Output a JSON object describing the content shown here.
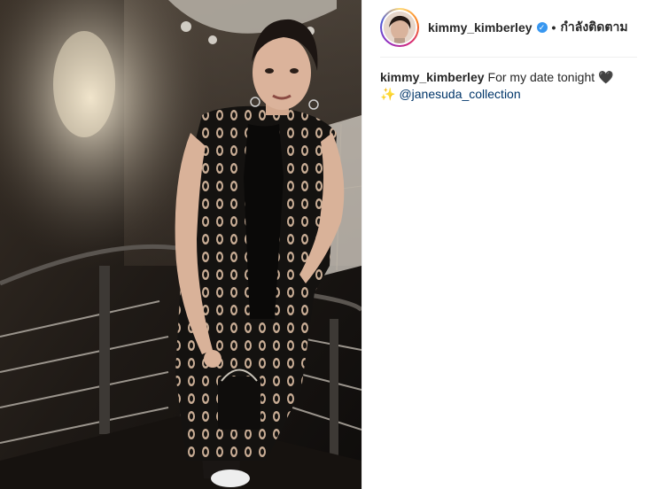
{
  "post": {
    "username": "kimmy_kimberley",
    "follow_status": "กำลังติดตาม",
    "separator": "•",
    "caption": {
      "username": "kimmy_kimberley",
      "text": "For my date tonight",
      "heart_emoji": "🖤",
      "sparkle_emoji": "✨",
      "mention": "@janesuda_collection"
    },
    "verified_icon": "verified-badge-icon",
    "photo_alt": "Woman in black lace dress standing on spiral staircase"
  },
  "colors": {
    "link": "#003569",
    "verified": "#3897f0",
    "text": "#262626"
  }
}
